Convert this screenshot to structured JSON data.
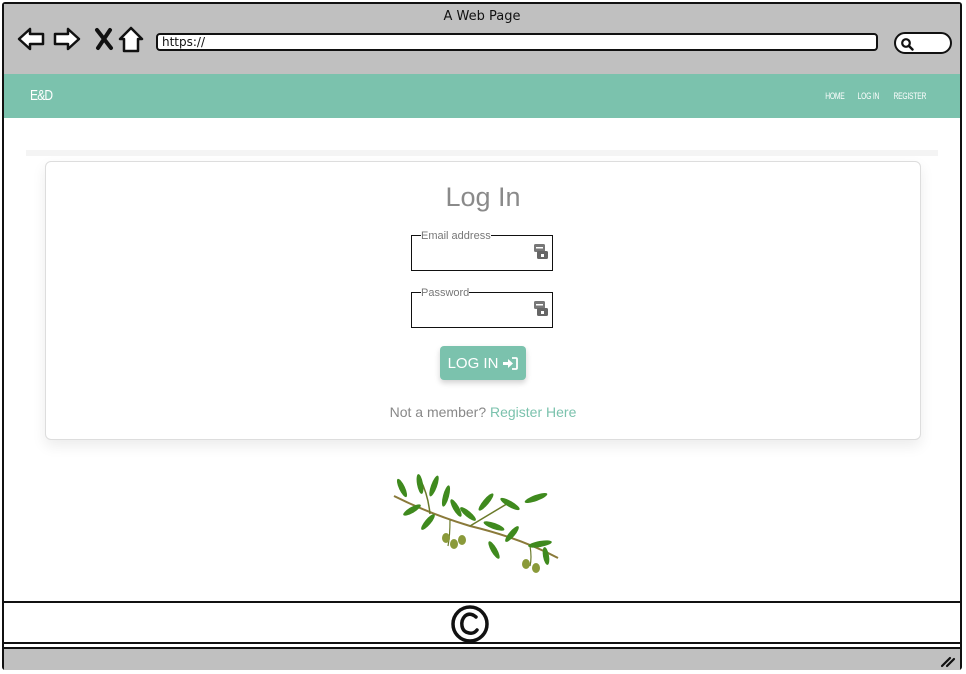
{
  "window": {
    "title": "A Web Page"
  },
  "browser": {
    "url": "https://",
    "icons": [
      "back-arrow-icon",
      "forward-arrow-icon",
      "close-x-icon",
      "home-icon",
      "search-icon"
    ]
  },
  "navbar": {
    "brand": "E&D",
    "links": [
      "HOME",
      "LOG IN",
      "REGISTER"
    ],
    "color": "#7bc2ad"
  },
  "login": {
    "title": "Log In",
    "email_label": "Email address",
    "email_value": "",
    "password_label": "Password",
    "password_value": "",
    "button_label": "LOG IN",
    "button_icon": "sign-in-icon",
    "prompt": "Not a member?",
    "register_link": "Register Here"
  },
  "decoration": {
    "image": "olive-branch-image"
  },
  "footer": {
    "icon": "copyright-icon"
  },
  "colors": {
    "accent": "#7bc2ad",
    "chrome": "#c0c0c0",
    "title_gray": "#8a8a8a"
  }
}
